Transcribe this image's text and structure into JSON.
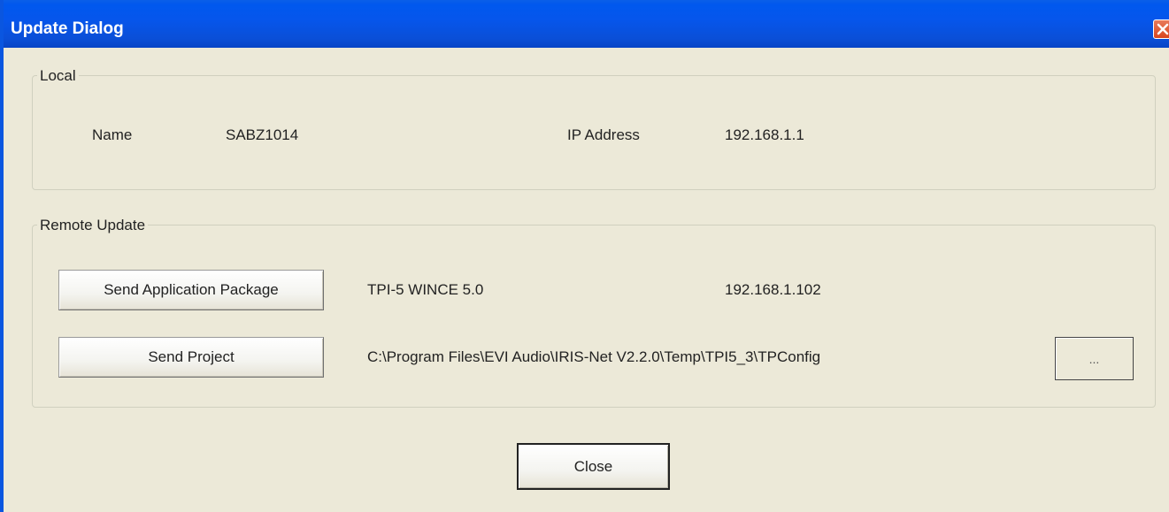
{
  "window": {
    "title": "Update Dialog"
  },
  "local": {
    "group_label": "Local",
    "name_label": "Name",
    "name_value": "SABZ1014",
    "ip_label": "IP Address",
    "ip_value": "192.168.1.1"
  },
  "remote": {
    "group_label": "Remote Update",
    "send_app_button": "Send Application Package",
    "device_value": "TPI-5 WINCE 5.0",
    "device_ip": "192.168.1.102",
    "send_project_button": "Send Project",
    "project_path": "C:\\Program Files\\EVI Audio\\IRIS-Net V2.2.0\\Temp\\TPI5_3\\TPConfig",
    "browse_button": "..."
  },
  "footer": {
    "close_button": "Close"
  },
  "colors": {
    "titlebar": "#0A56E0",
    "background": "#ECE9D8",
    "close_icon": "#D9461E"
  },
  "icons": {
    "close": "close-icon"
  }
}
